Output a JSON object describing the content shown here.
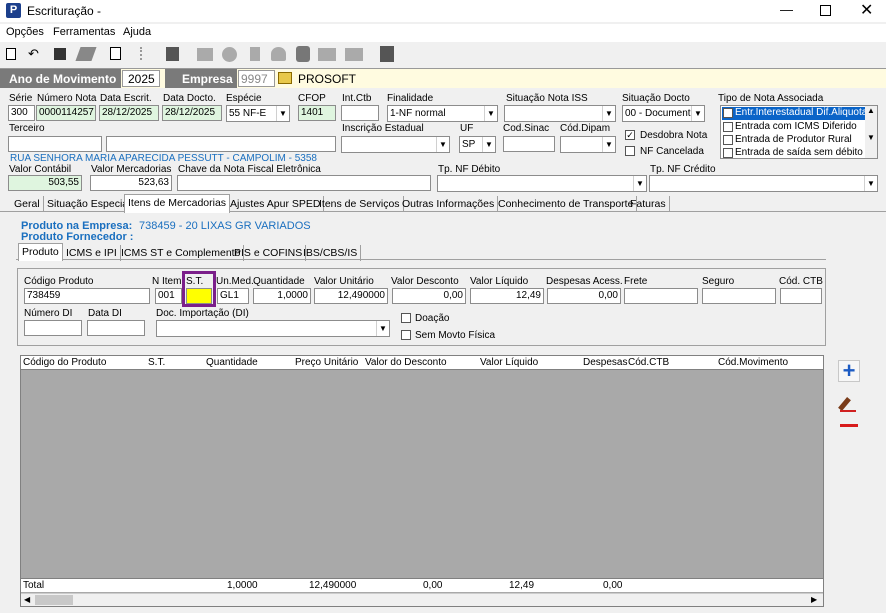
{
  "window": {
    "title": "Escrituração -",
    "icon_letter": "P"
  },
  "menu": [
    "Opções",
    "Ferramentas",
    "Ajuda"
  ],
  "header": {
    "ano_label": "Ano de Movimento",
    "ano_value": "2025",
    "empresa_label": "Empresa",
    "empresa_code": "9997",
    "empresa_name": "PROSOFT"
  },
  "top_labels": {
    "serie": "Série",
    "numero": "Número Nota",
    "data_escrit": "Data Escrit.",
    "data_docto": "Data Docto.",
    "especie": "Espécie",
    "cfop": "CFOP",
    "intctb": "Int.Ctb",
    "finalidade": "Finalidade",
    "sit_iss": "Situação Nota ISS",
    "sit_docto": "Situação Docto",
    "tipo_assoc": "Tipo de Nota Associada",
    "terceiro": "Terceiro",
    "insc_est": "Inscrição Estadual",
    "uf": "UF",
    "cod_sinac": "Cod.Sinac",
    "cod_dipam": "Cód.Dipam",
    "valor_contabil": "Valor Contábil",
    "valor_merc": "Valor Mercadorias",
    "chave": "Chave da Nota Fiscal Eletrônica",
    "tp_debito": "Tp. NF Débito",
    "tp_credito": "Tp. NF Crédito"
  },
  "top_values": {
    "serie": "300",
    "numero": "0000114257",
    "data_escrit": "28/12/2025",
    "data_docto": "28/12/2025",
    "especie": "55  NF-E",
    "cfop": "1401",
    "finalidade": "1-NF normal",
    "sit_docto": "00 - Document",
    "uf": "SP",
    "valor_contabil": "503,55",
    "valor_merc": "523,63",
    "address": "RUA SENHORA MARIA APARECIDA PESSUTT - CAMPOLIM - 5358"
  },
  "checks": {
    "desdobra": "Desdobra Nota",
    "cancelada": "NF Cancelada"
  },
  "assoc_list": [
    "Entr.Interestadual Dif.Aliquota",
    "Entrada com ICMS Diferido",
    "Entrada de Produtor Rural",
    "Entrada de saída sem débito"
  ],
  "tabs": [
    "Geral",
    "Situação Especial",
    "Itens de Mercadorias",
    "Ajustes Apur SPED",
    "Itens de Serviços",
    "Outras Informações",
    "Conhecimento de Transporte",
    "Faturas"
  ],
  "produto": {
    "empresa_label": "Produto na Empresa:",
    "empresa_value": "738459 - 20 LIXAS GR VARIADOS",
    "fornecedor_label": "Produto Fornecedor :"
  },
  "subtabs": [
    "Produto",
    "ICMS e IPI",
    "ICMS ST e Complemento",
    "PIS e COFINS",
    "IBS/CBS/IS"
  ],
  "item_labels": {
    "codigo": "Código Produto",
    "n_item": "N Item",
    "st": "S.T.",
    "un_med": "Un.Med.",
    "quantidade": "Quantidade",
    "valor_unit": "Valor Unitário",
    "valor_desc": "Valor Desconto",
    "valor_liq": "Valor Líquido",
    "despesas": "Despesas Acess.",
    "frete": "Frete",
    "seguro": "Seguro",
    "cod_ctb": "Cód. CTB",
    "numero_di": "Número DI",
    "data_di": "Data DI",
    "doc_import": "Doc. Importação (DI)",
    "doacao": "Doação",
    "sem_movto": "Sem Movto Física"
  },
  "item_values": {
    "codigo": "738459",
    "n_item": "001",
    "st": "",
    "un_med": "GL1",
    "quantidade": "1,0000",
    "valor_unit": "12,490000",
    "valor_desc": "0,00",
    "valor_liq": "12,49",
    "despesas": "0,00"
  },
  "grid": {
    "columns": [
      "Código do Produto",
      "S.T.",
      "Quantidade",
      "Preço Unitário",
      "Valor do Desconto",
      "Valor Líquido",
      "Despesas",
      "Cód.CTB",
      "Cód.Movimento"
    ],
    "total": {
      "label": "Total",
      "quantidade": "1,0000",
      "preco": "12,490000",
      "desconto": "0,00",
      "liquido": "12,49",
      "despesas": "0,00"
    }
  },
  "colors": {
    "header_bar": "#7a7a7a",
    "highlight_border": "#7b1f8a",
    "st_field": "#ffff00",
    "blue_text": "#1a6fbf"
  }
}
